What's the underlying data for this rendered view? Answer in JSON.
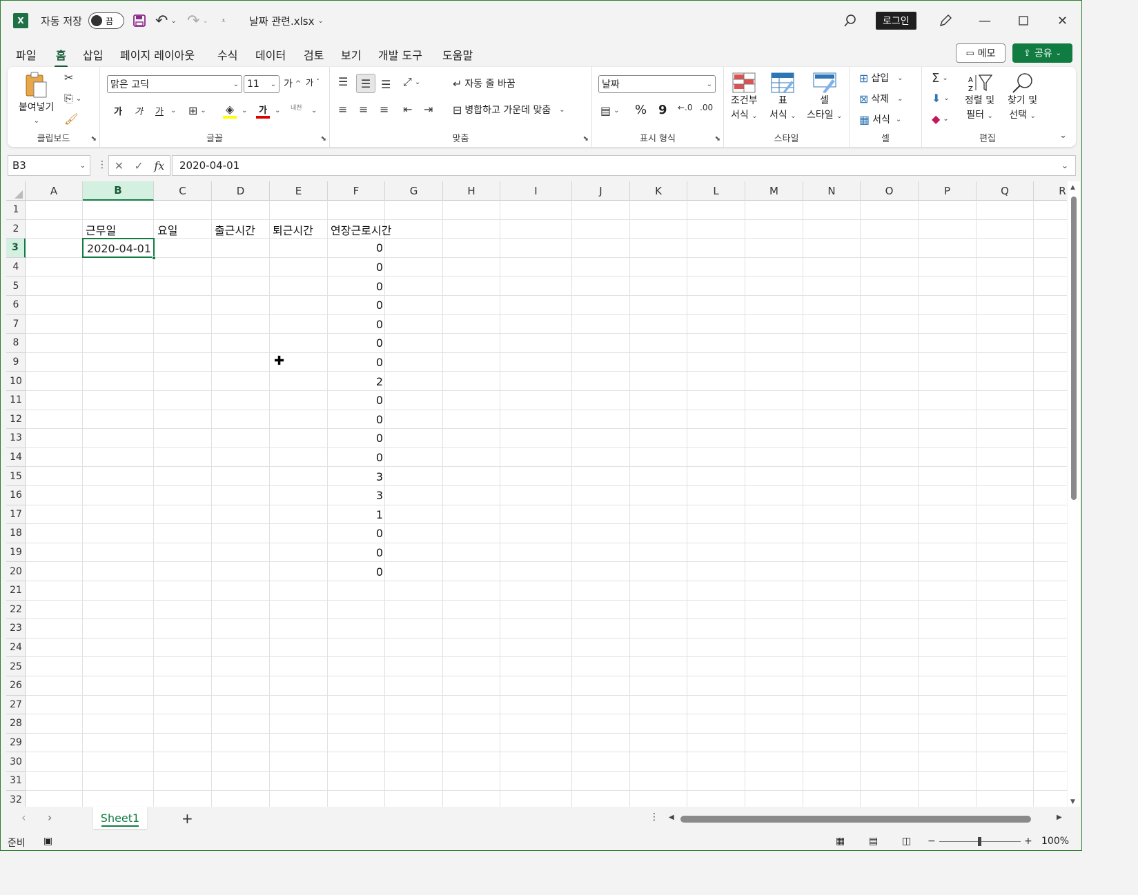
{
  "titlebar": {
    "autosave_label": "자동 저장",
    "autosave_state": "끔",
    "filename": "날짜 관련.xlsx",
    "login": "로그인"
  },
  "menu": {
    "tabs": [
      "파일",
      "홈",
      "삽입",
      "페이지 레이아웃",
      "수식",
      "데이터",
      "검토",
      "보기",
      "개발 도구",
      "도움말"
    ],
    "active_tab": "홈",
    "memo": "메모",
    "share": "공유"
  },
  "ribbon": {
    "clipboard": {
      "paste": "붙여넣기",
      "label": "클립보드"
    },
    "font": {
      "name": "맑은 고딕",
      "size": "11",
      "bold": "가",
      "italic": "가",
      "underline": "가",
      "font_color": "가",
      "phonetic": "내천",
      "grow": "가",
      "shrink": "가",
      "label": "글꼴"
    },
    "alignment": {
      "wrap_text": "자동 줄 바꿈",
      "merge_center": "병합하고 가운데 맞춤",
      "label": "맞춤"
    },
    "number": {
      "format": "날짜",
      "percent": "%",
      "comma": "9",
      "label": "표시 형식"
    },
    "styles": {
      "conditional_1": "조건부",
      "conditional_2": "서식",
      "table_1": "표",
      "table_2": "서식",
      "cell_1": "셀",
      "cell_2": "스타일",
      "label": "스타일"
    },
    "cells": {
      "insert": "삽입",
      "delete": "삭제",
      "format": "서식",
      "label": "셀"
    },
    "editing": {
      "sort_1": "정렬 및",
      "sort_2": "필터",
      "find_1": "찾기 및",
      "find_2": "선택",
      "label": "편집",
      "sum": "Σ"
    }
  },
  "formula_bar": {
    "name_box": "B3",
    "fx": "fx",
    "formula": "2020-04-01"
  },
  "sheet": {
    "columns": [
      "A",
      "B",
      "C",
      "D",
      "E",
      "F",
      "G",
      "H",
      "I",
      "J",
      "K",
      "L",
      "M",
      "N",
      "O",
      "P",
      "Q",
      "R"
    ],
    "rows": [
      "1",
      "2",
      "3",
      "4",
      "5",
      "6",
      "7",
      "8",
      "9",
      "10",
      "11",
      "12",
      "13",
      "14",
      "15",
      "16",
      "17",
      "18",
      "19",
      "20",
      "21",
      "22",
      "23",
      "24",
      "25",
      "26",
      "27",
      "28",
      "29",
      "30",
      "31",
      "32"
    ],
    "selected_cell": "B3",
    "headers": {
      "B2": "근무일",
      "C2": "요일",
      "D2": "출근시간",
      "E2": "퇴근시간",
      "F2": "연장근로시간"
    },
    "b3_value": "2020-04-01",
    "f_values": [
      "0",
      "0",
      "0",
      "0",
      "0",
      "0",
      "0",
      "2",
      "0",
      "0",
      "0",
      "0",
      "3",
      "3",
      "1",
      "0",
      "0",
      "0"
    ]
  },
  "tabs": {
    "sheet1": "Sheet1",
    "add": "+"
  },
  "status": {
    "ready": "준비",
    "zoom": "100%"
  },
  "colors": {
    "accent": "#107c41",
    "selection_header": "#d3f0e0"
  }
}
